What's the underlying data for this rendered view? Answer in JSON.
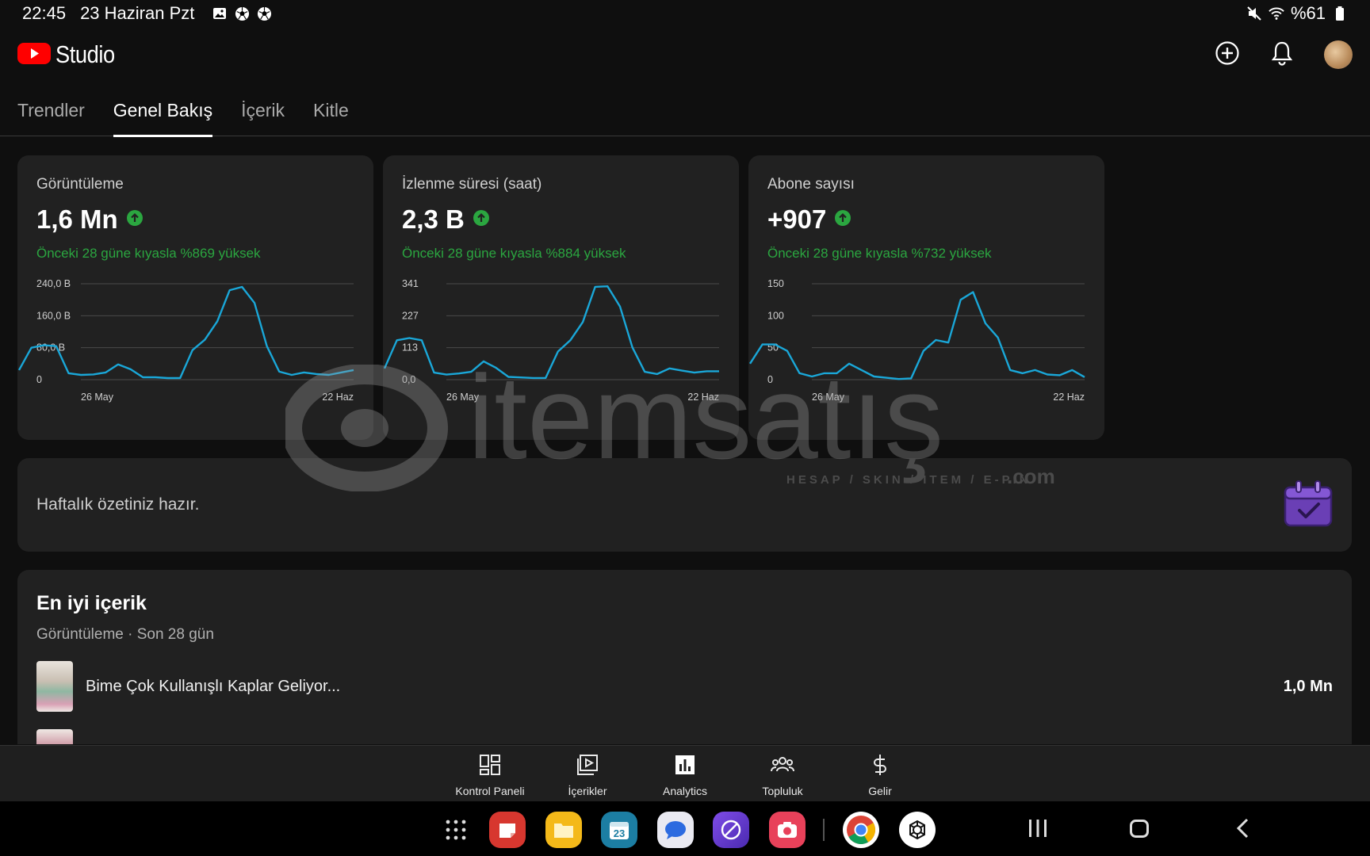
{
  "status_bar": {
    "time": "22:45",
    "date": "23 Haziran Pzt",
    "battery": "%61",
    "icons": [
      "image-icon",
      "soccer-ball-icon",
      "soccer-ball-icon",
      "mute-icon",
      "wifi-icon",
      "battery-icon"
    ]
  },
  "header": {
    "app_name": "Studio",
    "actions": [
      "create-icon",
      "bell-icon",
      "avatar"
    ]
  },
  "tabs": [
    {
      "label": "Trendler",
      "active": false
    },
    {
      "label": "Genel Bakış",
      "active": true
    },
    {
      "label": "İçerik",
      "active": false
    },
    {
      "label": "Kitle",
      "active": false
    }
  ],
  "cards": [
    {
      "title": "Görüntüleme",
      "value": "1,6 Mn",
      "comparison": "Önceki 28 güne kıyasla %869 yüksek",
      "y_ticks": [
        "240,0 B",
        "160,0 B",
        "80,0 B",
        "0"
      ],
      "x_start": "26 May",
      "x_end": "22 Haz"
    },
    {
      "title": "İzlenme süresi (saat)",
      "value": "2,3 B",
      "comparison": "Önceki 28 güne kıyasla %884 yüksek",
      "y_ticks": [
        "341",
        "227",
        "113",
        "0,0"
      ],
      "x_start": "26 May",
      "x_end": "22 Haz"
    },
    {
      "title": "Abone sayısı",
      "value": "+907",
      "comparison": "Önceki 28 güne kıyasla %732 yüksek",
      "y_ticks": [
        "150",
        "100",
        "50",
        "0"
      ],
      "x_start": "26 May",
      "x_end": "22 Haz"
    }
  ],
  "chart_data": [
    {
      "type": "line",
      "title": "Görüntüleme",
      "ylim": [
        0,
        240000
      ],
      "x_start": "26 May",
      "x_end": "22 Haz",
      "color": "#1aa7d8",
      "values": [
        24000,
        80000,
        86000,
        84000,
        16000,
        12000,
        13000,
        18000,
        38000,
        26000,
        6000,
        6000,
        4000,
        4000,
        74000,
        100000,
        146000,
        224000,
        232000,
        192000,
        84000,
        20000,
        12000,
        18000,
        14000,
        12000,
        18000,
        24000
      ]
    },
    {
      "type": "line",
      "title": "İzlenme süresi (saat)",
      "ylim": [
        0,
        341
      ],
      "x_start": "26 May",
      "x_end": "22 Haz",
      "color": "#1aa7d8",
      "values": [
        40,
        140,
        148,
        140,
        25,
        18,
        22,
        28,
        65,
        42,
        10,
        8,
        6,
        6,
        100,
        140,
        205,
        330,
        332,
        260,
        115,
        28,
        20,
        40,
        32,
        25,
        30,
        30
      ]
    },
    {
      "type": "line",
      "title": "Abone sayısı",
      "ylim": [
        0,
        150
      ],
      "x_start": "26 May",
      "x_end": "22 Haz",
      "color": "#1aa7d8",
      "values": [
        25,
        55,
        55,
        45,
        10,
        5,
        10,
        10,
        25,
        15,
        5,
        3,
        1,
        2,
        45,
        62,
        58,
        125,
        137,
        88,
        66,
        15,
        10,
        15,
        8,
        7,
        15,
        4
      ]
    }
  ],
  "weekly": {
    "text": "Haftalık özetiniz hazır."
  },
  "best": {
    "title": "En iyi içerik",
    "subtitle": "Görüntüleme · Son 28 gün",
    "rows": [
      {
        "title": "Bime Çok Kullanışlı Kaplar Geliyor...",
        "value": "1,0 Mn"
      }
    ]
  },
  "bottom_nav": [
    {
      "label": "Kontrol Paneli",
      "icon": "dashboard-icon"
    },
    {
      "label": "İçerikler",
      "icon": "content-icon"
    },
    {
      "label": "Analytics",
      "icon": "analytics-icon"
    },
    {
      "label": "Topluluk",
      "icon": "community-icon"
    },
    {
      "label": "Gelir",
      "icon": "earn-icon"
    }
  ],
  "dock": {
    "calendar_day": "23"
  },
  "watermark": {
    "brand": "itemsatış",
    "tagline": "HESAP / SKIN / ITEM / E-PIN",
    "suffix": ".com"
  }
}
